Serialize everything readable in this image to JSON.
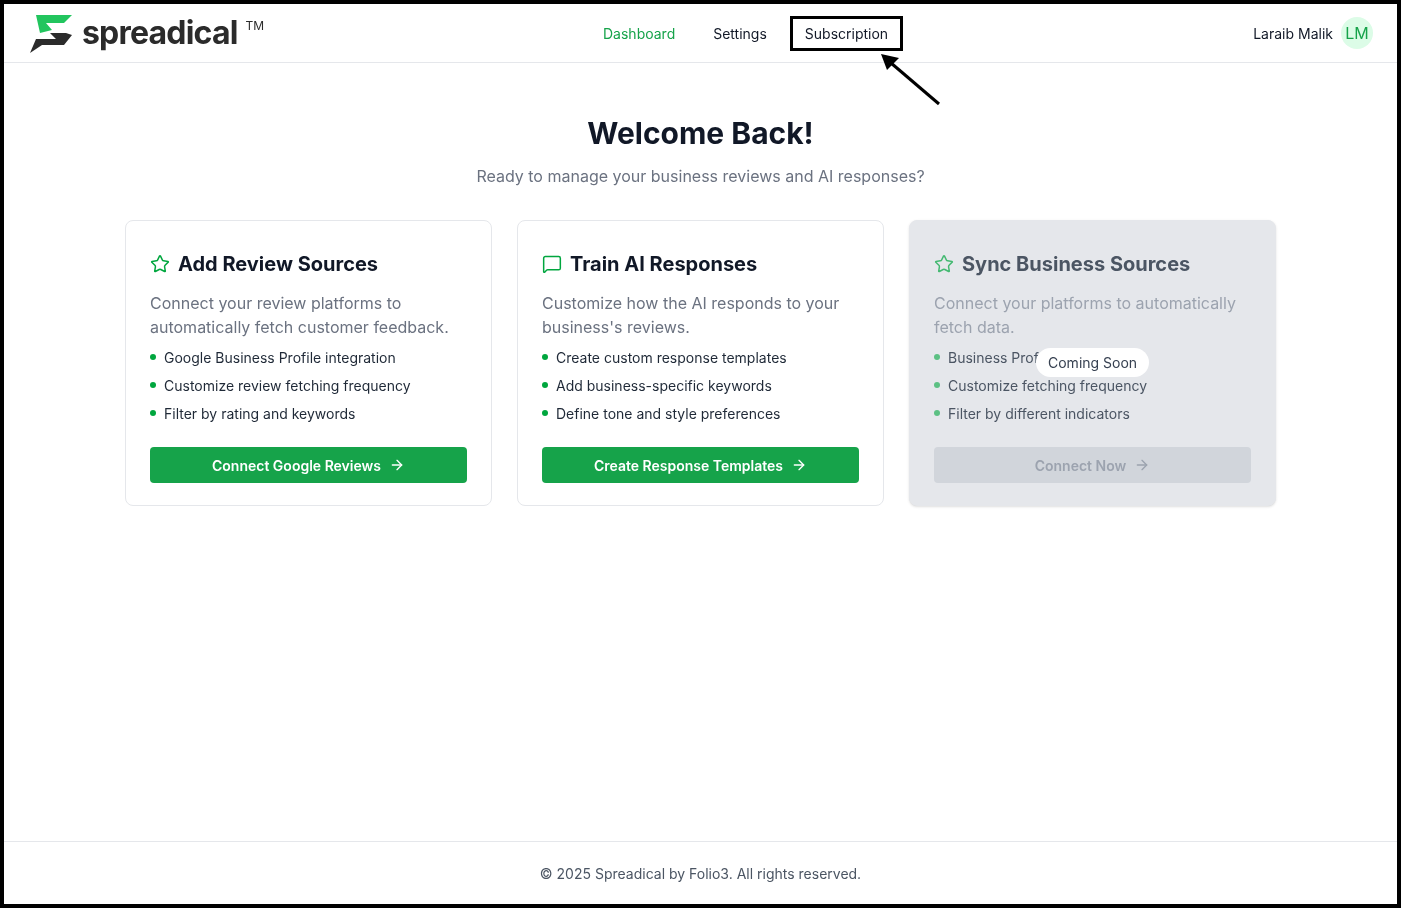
{
  "header": {
    "logo": {
      "name": "spreadical",
      "mark": "TM"
    },
    "nav": [
      {
        "label": "Dashboard",
        "selected": true,
        "highlighted": false
      },
      {
        "label": "Settings",
        "selected": false,
        "highlighted": false
      },
      {
        "label": "Subscription",
        "selected": false,
        "highlighted": true
      }
    ],
    "user": {
      "name": "Laraib Malik",
      "initials": "LM"
    }
  },
  "welcome": {
    "title": "Welcome Back!",
    "subtitle": "Ready to manage your business reviews and AI responses?"
  },
  "cards": [
    {
      "kind": "star",
      "title": "Add Review Sources",
      "description": "Connect your review platforms to automatically fetch customer feedback.",
      "features": [
        "Google Business Profile integration",
        "Customize review fetching frequency",
        "Filter by rating and keywords"
      ],
      "button": "Connect Google Reviews",
      "disabled": false
    },
    {
      "kind": "message",
      "title": "Train AI Responses",
      "description": "Customize how the AI responds to your business's reviews.",
      "features": [
        "Create custom response templates",
        "Add business-specific keywords",
        "Define tone and style preferences"
      ],
      "button": "Create Response Templates",
      "disabled": false
    },
    {
      "kind": "star",
      "title": "Sync Business Sources",
      "description": "Connect your platforms to automatically fetch data.",
      "features": [
        "Business Prof",
        "Customize fetching frequency",
        "Filter by different indicators"
      ],
      "button": "Connect Now",
      "disabled": true,
      "badge": "Coming Soon"
    }
  ],
  "footer": {
    "text": "© 2025 Spreadical by Folio3. All rights reserved."
  }
}
